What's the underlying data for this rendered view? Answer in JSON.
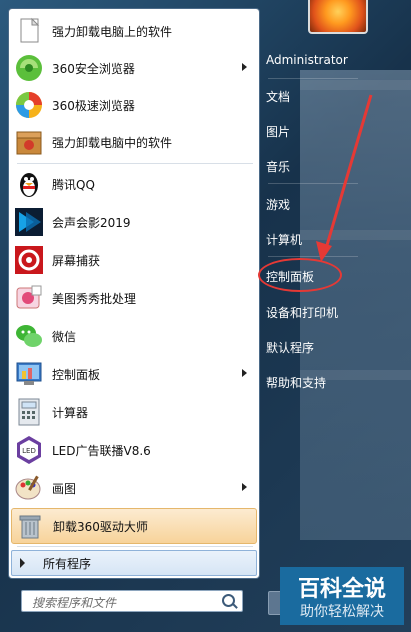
{
  "start_menu": {
    "programs": [
      {
        "label": "强力卸载电脑上的软件",
        "icon": "document-icon"
      },
      {
        "label": "360安全浏览器",
        "icon": "360-browser-icon",
        "has_submenu": true
      },
      {
        "label": "360极速浏览器",
        "icon": "360-speed-browser-icon"
      },
      {
        "label": "强力卸载电脑中的软件",
        "icon": "uninstall-box-icon"
      },
      {
        "label": "腾讯QQ",
        "icon": "qq-penguin-icon"
      },
      {
        "label": "会声会影2019",
        "icon": "video-editor-icon"
      },
      {
        "label": "屏幕捕获",
        "icon": "screen-capture-icon"
      },
      {
        "label": "美图秀秀批处理",
        "icon": "meitu-icon"
      },
      {
        "label": "微信",
        "icon": "wechat-icon"
      },
      {
        "label": "控制面板",
        "icon": "control-panel-icon",
        "has_submenu": true
      },
      {
        "label": "计算器",
        "icon": "calculator-icon"
      },
      {
        "label": "LED广告联播V8.6",
        "icon": "led-icon"
      },
      {
        "label": "画图",
        "icon": "paint-icon",
        "has_submenu": true
      },
      {
        "label": "卸载360驱动大师",
        "icon": "trash-bin-icon",
        "highlighted": true
      }
    ],
    "all_programs": "所有程序",
    "search_placeholder": "搜索程序和文件",
    "right_links": [
      "Administrator",
      "文档",
      "图片",
      "音乐",
      "游戏",
      "计算机",
      "控制面板",
      "设备和打印机",
      "默认程序",
      "帮助和支持"
    ]
  },
  "watermark": {
    "title": "百科全说",
    "subtitle": "助你轻松解决"
  },
  "colors": {
    "highlight": "#f7d39a",
    "annotation": "#e53935",
    "watermark_bg": "#1a6b9f"
  }
}
